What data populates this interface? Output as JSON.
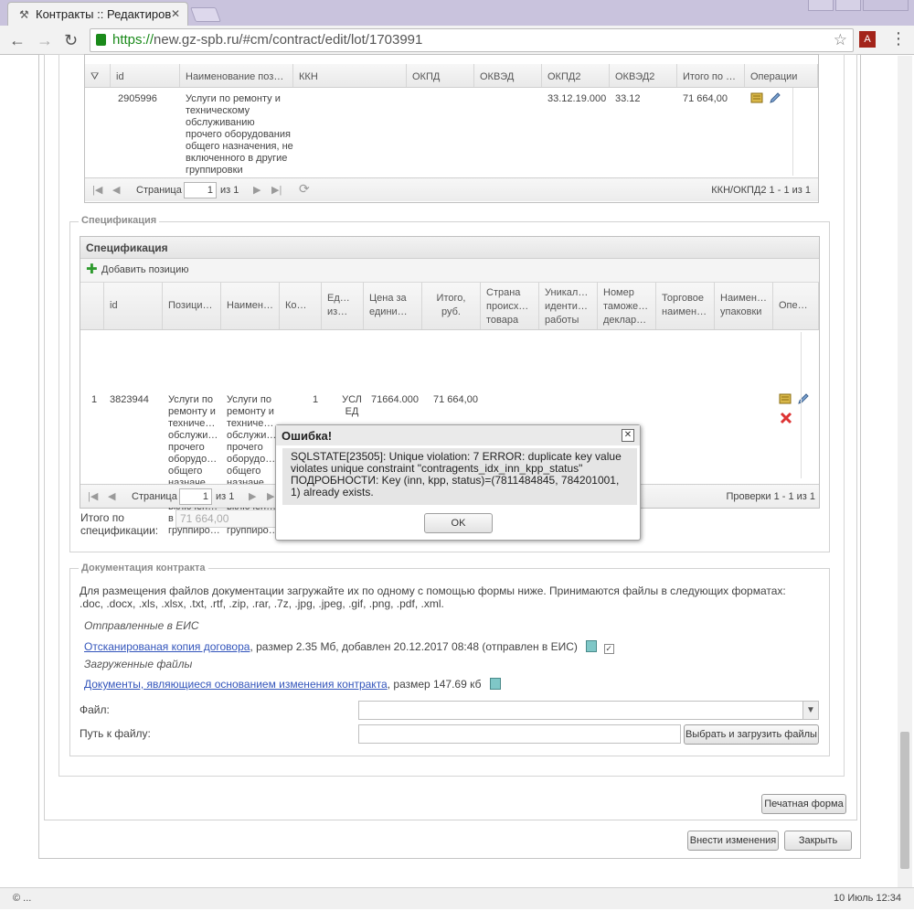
{
  "browser": {
    "tab_title": "Контракты :: Редактиров",
    "url_scheme": "https://",
    "url_rest": "new.gz-spb.ru/#cm/contract/edit/lot/1703991"
  },
  "kkn_grid": {
    "headers": [
      "id",
      "Наименование пози…",
      "ККН",
      "ОКПД",
      "ОКВЭД",
      "ОКПД2",
      "ОКВЭД2",
      "Итого по п…",
      "Операции"
    ],
    "row": {
      "id": "2905996",
      "name": "Услуги по ремонту и техническому обслуживанию прочего оборудования общего назначения, не включенного в другие группировки",
      "okpd2": "33.12.19.000",
      "okved2": "33.12",
      "total": "71 664,00"
    },
    "pager": {
      "page_label": "Страница",
      "page": "1",
      "of": "из 1",
      "summary": "ККН/ОКПД2 1 - 1 из 1"
    }
  },
  "spec": {
    "legend": "Спецификация",
    "panel_title": "Спецификация",
    "add_label": "Добавить позицию",
    "headers": [
      "id",
      "Позиция…",
      "Наимен…",
      "Ко…",
      "Ед… из…",
      "Цена за едини…",
      "Итого, руб.",
      "Страна происхо… товара",
      "Уникаль… идентиф… работы у…",
      "Номер таможен… деклара…",
      "Торговое наимено…",
      "Наимен… упаковки",
      "Опера…"
    ],
    "row": {
      "num": "1",
      "id": "3823944",
      "position_lines": [
        "Услуги по",
        "ремонту и",
        "техниче…",
        "обслужи…",
        "прочего",
        "оборудо…",
        "общего",
        "назначе…",
        "не",
        "включен…",
        "в другие",
        "группиро…"
      ],
      "qty": "1",
      "unit_lines": [
        "УСЛ",
        "ЕД"
      ],
      "price": "71664.000",
      "total": "71 664,00"
    },
    "pager": {
      "page_label": "Страница",
      "page": "1",
      "of": "из 1",
      "summary": "Проверки 1 - 1 из 1"
    },
    "total_label_1": "Итого по",
    "total_label_2": "спецификации:",
    "total_value": "71 664,00"
  },
  "docs": {
    "legend": "Документация контракта",
    "intro": "Для размещения файлов документации загружайте их по одному с помощью формы ниже. Принимаются файлы в следующих форматах:",
    "formats": ".doc, .docx, .xls, .xlsx, .txt, .rtf, .zip, .rar, .7z, .jpg, .jpeg, .gif, .png, .pdf, .xml.",
    "sent_heading": "Отправленные в ЕИС",
    "sent_link": "Отсканированая копия договора",
    "sent_meta": ", размер 2.35 Мб, добавлен 20.12.2017 08:48 (отправлен в ЕИС)",
    "uploaded_heading": "Загруженные файлы",
    "uploaded_link": "Документы, являющиеся основанием изменения контракта",
    "uploaded_meta": ", размер 147.69 кб",
    "file_label": "Файл:",
    "path_label": "Путь к файлу:",
    "choose_button": "Выбрать и загрузить файлы"
  },
  "buttons": {
    "print": "Печатная форма",
    "apply": "Внести изменения",
    "close": "Закрыть"
  },
  "dialog": {
    "title": "Ошибка!",
    "message_1": "SQLSTATE[23505]: Unique violation: 7 ERROR: duplicate key value",
    "message_2": "violates unique constraint \"contragents_idx_inn_kpp_status\"",
    "message_3": "ПОДРОБНОСТИ: Key (inn, kpp, status)=(7811484845, 784201001,",
    "message_4": "1) already exists.",
    "ok": "OK"
  },
  "statusbar": {
    "left": "© ...",
    "right": "10 Июль 12:34"
  }
}
